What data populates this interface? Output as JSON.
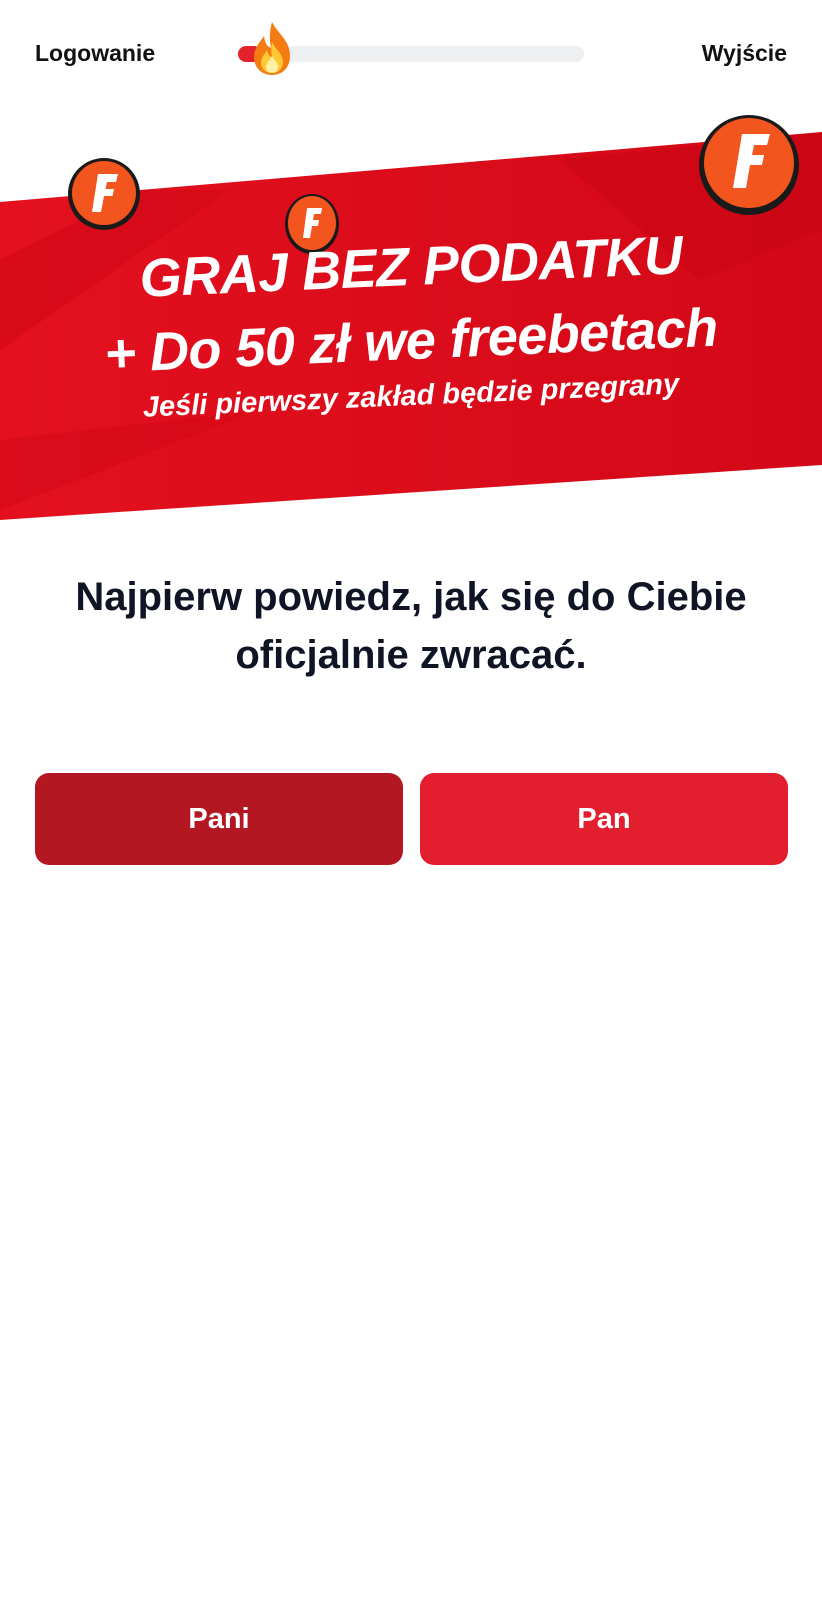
{
  "header": {
    "login_label": "Logowanie",
    "exit_label": "Wyjście",
    "progress_fraction": 0.07,
    "progress_icon": "flame-icon"
  },
  "banner": {
    "headline": "GRAJ BEZ PODATKU",
    "subheadline": "+ Do 50 zł we freebetach",
    "condition": "Jeśli pierwszy zakład będzie przegrany",
    "coin_letter": "F",
    "colors": {
      "banner_red": "#e0101f",
      "coin_orange": "#f2561e"
    }
  },
  "question": {
    "text": "Najpierw powiedz, jak się do Ciebie oficjalnie zwracać."
  },
  "choices": {
    "pani": "Pani",
    "pan": "Pan",
    "colors": {
      "pani": "#b31722",
      "pan": "#e31f2f"
    }
  }
}
